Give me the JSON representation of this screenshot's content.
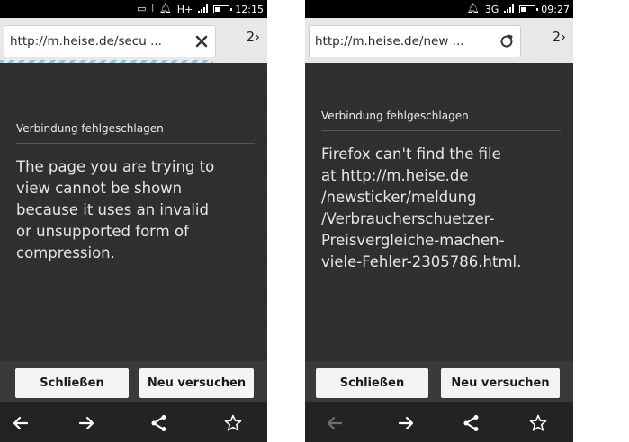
{
  "screens": [
    {
      "status": {
        "network": "H+",
        "time": "12:15"
      },
      "url": "http://m.heise.de/secu ...",
      "url_action_icon": "close-icon",
      "tab_count": "2›",
      "error": {
        "title": "Verbindung fehlgeschlagen",
        "body": "The page you are trying to\nview cannot be shown\nbecause it uses an invalid\nor unsupported form of\ncompression."
      },
      "buttons": {
        "close": "Schließen",
        "retry": "Neu versuchen"
      },
      "nav": {
        "back_enabled": true
      }
    },
    {
      "status": {
        "network": "3G",
        "time": "09:27"
      },
      "url": "http://m.heise.de/new  ...",
      "url_action_icon": "reload-icon",
      "tab_count": "2›",
      "error": {
        "title": "Verbindung fehlgeschlagen",
        "body": "Firefox can't find the file\nat http://m.heise.de\n/newsticker/meldung\n/Verbraucherschuetzer-\nPreisvergleiche-machen-\nviele-Fehler-2305786.html."
      },
      "buttons": {
        "close": "Schließen",
        "retry": "Neu versuchen"
      },
      "nav": {
        "back_enabled": false
      }
    }
  ]
}
